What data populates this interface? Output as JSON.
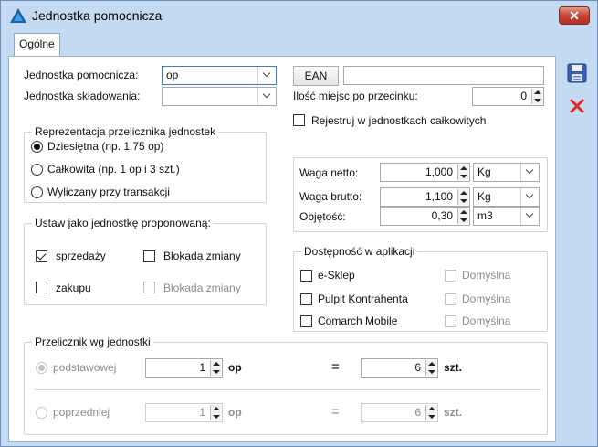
{
  "window": {
    "title": "Jednostka pomocnicza",
    "close_glyph": "✕"
  },
  "tabs": [
    {
      "label": "Ogólne"
    }
  ],
  "side_buttons": {
    "save_icon": "floppy-disk-icon",
    "cancel_icon": "close-icon"
  },
  "unit": {
    "pomocnicza_label": "Jednostka pomocnicza:",
    "pomocnicza_value": "op",
    "skladowania_label": "Jednostka składowania:",
    "skladowania_value": ""
  },
  "ean": {
    "button_label": "EAN",
    "value": ""
  },
  "decimals": {
    "label": "Ilość miejsc po przecinku:",
    "value": "0"
  },
  "register_whole": {
    "label": "Rejestruj w jednostkach całkowitych",
    "checked": false
  },
  "representation": {
    "title": "Reprezentacja przelicznika jednostek",
    "options": [
      {
        "label": "Dziesiętna (np. 1.75 op)",
        "selected": true
      },
      {
        "label": "Całkowita (np. 1 op i 3 szt.)",
        "selected": false
      },
      {
        "label": "Wyliczany przy transakcji",
        "selected": false
      }
    ]
  },
  "weights": {
    "netto_label": "Waga netto:",
    "netto_value": "1,000",
    "netto_unit": "Kg",
    "brutto_label": "Waga brutto:",
    "brutto_value": "1,100",
    "brutto_unit": "Kg",
    "volume_label": "Objętość:",
    "volume_value": "0,30",
    "volume_unit": "m3"
  },
  "proposed": {
    "title": "Ustaw jako jednostkę proponowaną:",
    "sales_label": "sprzedaży",
    "sales_checked": true,
    "purchase_label": "zakupu",
    "purchase_checked": false,
    "block1_label": "Blokada zmiany",
    "block1_checked": false,
    "block2_label": "Blokada zmiany",
    "block2_checked": false
  },
  "availability": {
    "title": "Dostępność w aplikacji",
    "items": [
      {
        "label": "e-Sklep",
        "default_label": "Domyślna"
      },
      {
        "label": "Pulpit Kontrahenta",
        "default_label": "Domyślna"
      },
      {
        "label": "Comarch Mobile",
        "default_label": "Domyślna"
      }
    ]
  },
  "converter": {
    "title": "Przelicznik wg jednostki",
    "basic_label": "podstawowej",
    "basic_qty": "1",
    "basic_unit": "op",
    "basic_eq": "=",
    "basic_target_qty": "6",
    "basic_target_unit": "szt.",
    "prev_label": "poprzedniej",
    "prev_qty": "1",
    "prev_unit": "op",
    "prev_eq": "=",
    "prev_target_qty": "6",
    "prev_target_unit": "szt."
  },
  "colors": {
    "title_bar": "#c4daf3",
    "close_red": "#c5443b",
    "accent": "#3b7bd1"
  }
}
